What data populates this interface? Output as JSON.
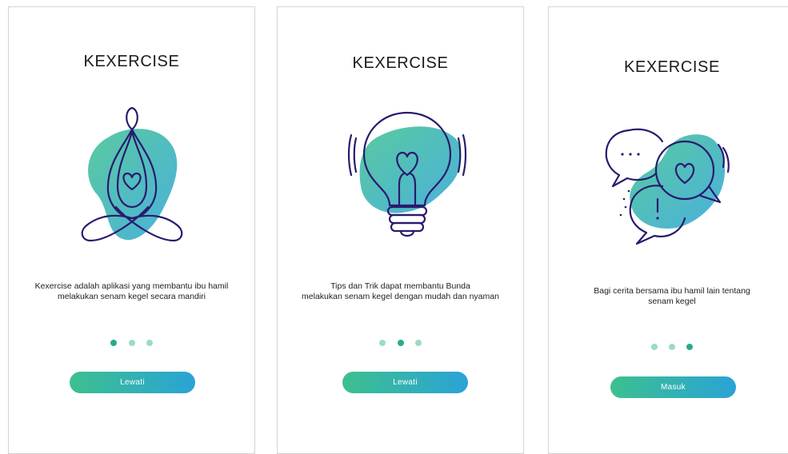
{
  "colors": {
    "accent_green": "#3cc08f",
    "accent_blue": "#2aa3d6",
    "line_purple": "#2a1a6e",
    "dot_active": "#2aa98d",
    "dot_inactive": "#9ed9cc"
  },
  "screens": [
    {
      "title": "KEXERCISE",
      "illustration": "meditation-heart-icon",
      "description": [
        "Kexercise adalah aplikasi yang membantu ibu hamil",
        "melakukan senam kegel secara mandiri"
      ],
      "active_dot": 0,
      "button_label": "Lewati"
    },
    {
      "title": "KEXERCISE",
      "illustration": "lightbulb-heart-icon",
      "description": [
        "Tips dan Trik dapat membantu Bunda",
        "melakukan senam kegel dengan mudah dan nyaman"
      ],
      "active_dot": 1,
      "button_label": "Lewati"
    },
    {
      "title": "KEXERCISE",
      "illustration": "chat-bubbles-heart-icon",
      "description": [
        "Bagi cerita bersama ibu hamil lain tentang",
        "senam kegel"
      ],
      "active_dot": 2,
      "button_label": "Masuk"
    }
  ]
}
